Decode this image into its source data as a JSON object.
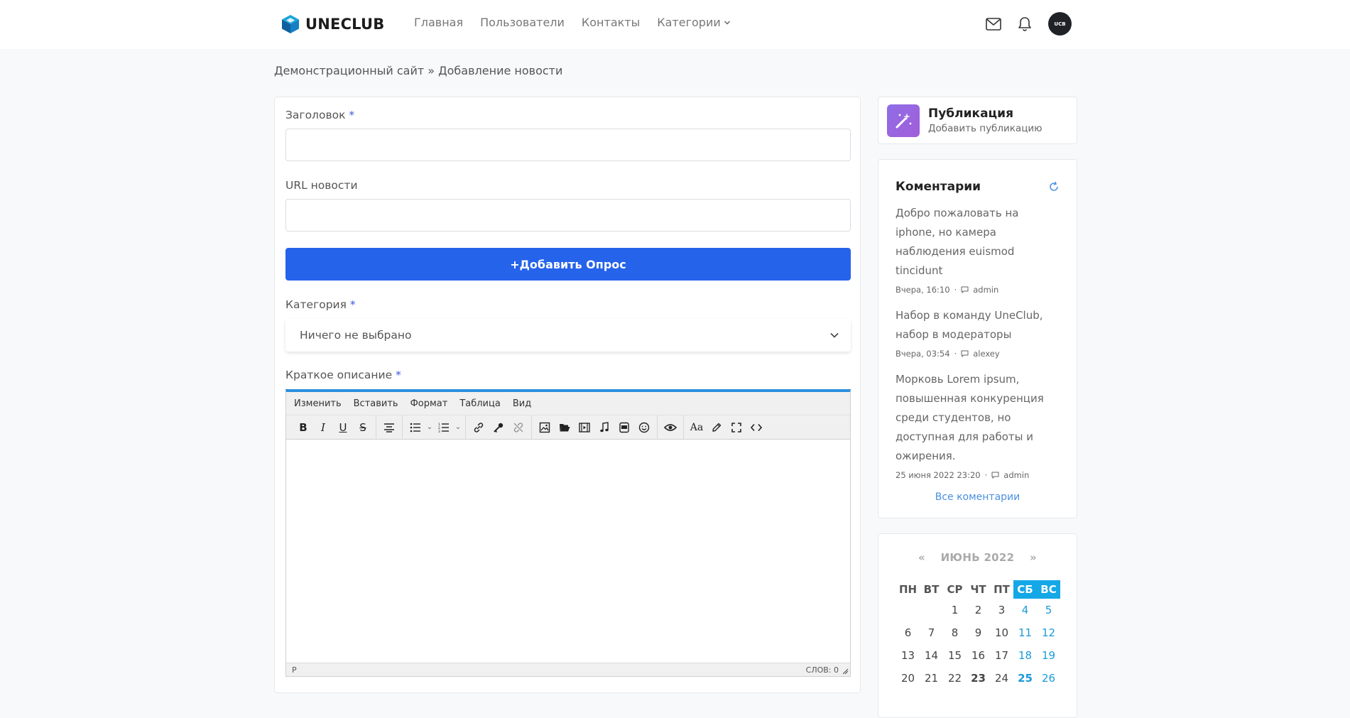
{
  "header": {
    "logo_text": "UNECLUB",
    "nav": [
      "Главная",
      "Пользователи",
      "Контакты",
      "Категории"
    ],
    "avatar_text": "UCB"
  },
  "breadcrumb": "Демонстрационный сайт » Добавление новости",
  "form": {
    "title_label": "Заголовок",
    "url_label": "URL новости",
    "title_value": "",
    "url_value": "",
    "add_poll_button": "+Добавить Опрос",
    "category_label": "Категория",
    "category_value": "Ничего не выбрано",
    "short_desc_label": "Краткое описание",
    "required_mark": "*"
  },
  "editor": {
    "menu": [
      "Изменить",
      "Вставить",
      "Формат",
      "Таблица",
      "Вид"
    ],
    "status_path": "P",
    "word_count": "СЛОВ: 0"
  },
  "sidebar": {
    "publication": {
      "title": "Публикация",
      "subtitle": "Добавить публикацию"
    },
    "comments": {
      "title": "Коментарии",
      "items": [
        {
          "text": "Добро пожаловать на iphone, но камера наблюдения euismod tincidunt",
          "time": "Вчера, 16:10",
          "author": "admin"
        },
        {
          "text": "Набор в команду UneClub, набор в модераторы",
          "time": "Вчера, 03:54",
          "author": "alexey"
        },
        {
          "text": "Морковь Lorem ipsum, повышенная конкуренция среди студентов, но доступная для работы и ожирения.",
          "time": "25 июня 2022 23:20",
          "author": "admin"
        }
      ],
      "all_link": "Все коментарии"
    },
    "calendar": {
      "prev": "«",
      "month": "ИЮНЬ 2022",
      "next": "»",
      "dow": [
        "ПН",
        "ВТ",
        "СР",
        "ЧТ",
        "ПТ",
        "СБ",
        "ВС"
      ],
      "weeks": [
        [
          "",
          "",
          "1",
          "2",
          "3",
          "4",
          "5"
        ],
        [
          "6",
          "7",
          "8",
          "9",
          "10",
          "11",
          "12"
        ],
        [
          "13",
          "14",
          "15",
          "16",
          "17",
          "18",
          "19"
        ],
        [
          "20",
          "21",
          "22",
          "23",
          "24",
          "25",
          "26"
        ]
      ],
      "bold_days": [
        "23",
        "25"
      ]
    }
  },
  "colors": {
    "primary": "#2563eb",
    "accent": "#14a8e6",
    "editor_border": "#2b8fe0"
  }
}
